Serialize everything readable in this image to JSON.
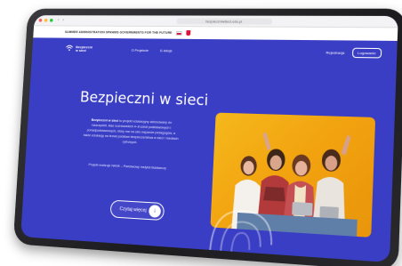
{
  "browser": {
    "url": "bezpieczniwsieci.edu.pl"
  },
  "gov_strip": {
    "text": "SUMMER ADMINISTRATION SPRAWS GOVERNMENTS FOR THE FUTURE"
  },
  "header": {
    "logo_line1": "Bezpieczni",
    "logo_line2": "w sieci",
    "nav": [
      {
        "label": "O Projekcie"
      },
      {
        "label": "E-lekcje"
      }
    ],
    "login_label": "Rejestracja",
    "register_label": "Logowanie"
  },
  "hero": {
    "title": "Bezpieczni w sieci",
    "description_bold": "Bezpieczni w sieci",
    "description_rest": " to projekt edukacyjny adresowany do nauczycieli, klas uczniowskich 4–8 szkół podstawowych i ponadpodstawowych, który ma na celu wsparcie pedagogów, a także edukację na temat podstaw bezpieczeństwa w sieci i mediach cyfrowych.",
    "note": "Projekt realizuje NASK – Państwowy Instytut Badawczy",
    "cta_label": "Czytaj więcej"
  },
  "colors": {
    "primary": "#3a3ec4",
    "photo_bg": "#f2a20f",
    "white": "#ffffff"
  }
}
